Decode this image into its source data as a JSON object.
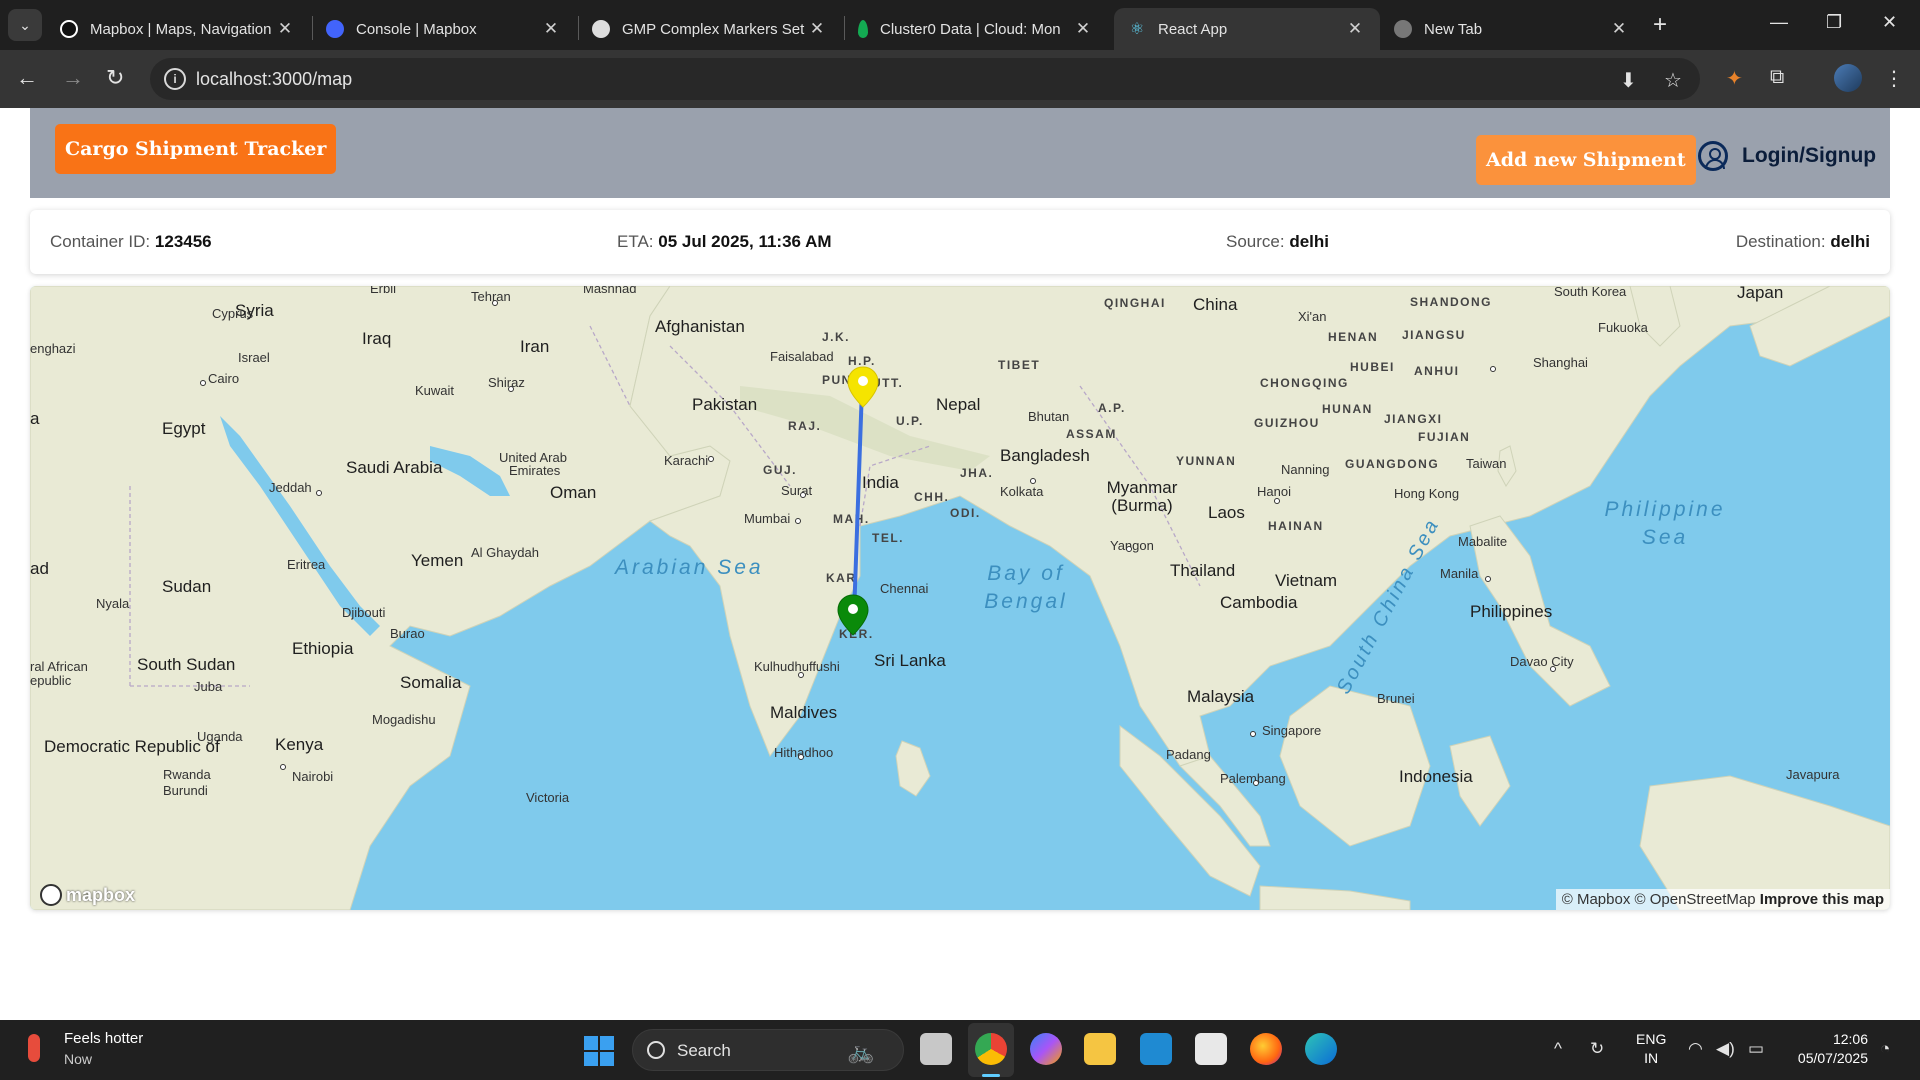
{
  "browser": {
    "tabs": [
      {
        "title": "Mapbox | Maps, Navigation",
        "favicon": "mapbox-icon",
        "active": false
      },
      {
        "title": "Console | Mapbox",
        "favicon": "mapbox-console-icon",
        "active": false
      },
      {
        "title": "GMP Complex Markers Set",
        "favicon": "gmp-icon",
        "active": false
      },
      {
        "title": "Cluster0 Data | Cloud: Mon",
        "favicon": "mongodb-leaf-icon",
        "active": false
      },
      {
        "title": "React App",
        "favicon": "react-icon",
        "active": true
      },
      {
        "title": "New Tab",
        "favicon": "chrome-icon",
        "active": false
      }
    ],
    "url": "localhost:3000/map"
  },
  "app": {
    "brand": "Cargo Shipment Tracker",
    "add_shipment": "Add new Shipment",
    "login": "Login/Signup",
    "colors": {
      "brand": "#f97316",
      "add_button": "#fb923c",
      "header_bg": "#9aa1ad"
    }
  },
  "shipment": {
    "container_label": "Container ID:",
    "container_id": "123456",
    "eta_label": "ETA:",
    "eta": "05 Jul 2025, 11:36 AM",
    "source_label": "Source:",
    "source": "delhi",
    "destination_label": "Destination:",
    "destination": "delhi"
  },
  "map": {
    "countries": [
      "Syria",
      "Iraq",
      "Iran",
      "Afghanistan",
      "China",
      "Japan",
      "Pakistan",
      "Nepal",
      "Bhutan",
      "Egypt",
      "Saudi Arabia",
      "Oman",
      "India",
      "Bangladesh",
      "Myanmar (Burma)",
      "Laos",
      "Taiwan",
      "Yemen",
      "Sudan",
      "Eritrea",
      "Thailand",
      "Vietnam",
      "Cambodia",
      "Philippines",
      "Djibouti",
      "Ethiopia",
      "Sri Lanka",
      "South Sudan",
      "Somalia",
      "Maldives",
      "Malaysia",
      "Brunei",
      "Kenya",
      "Uganda",
      "Rwanda",
      "Burundi",
      "Indonesia",
      "Democratic Republic of",
      "ral African",
      "epublic",
      "South Korea",
      "ad",
      "a"
    ],
    "cities": [
      "Erbil",
      "Tehran",
      "Mashhad",
      "Cyprus",
      "Israel",
      "Cairo",
      "Kuwait",
      "Shiraz",
      "Faisalabad",
      "Xi'an",
      "Fukuoka",
      "Shanghai",
      "Jeddah",
      "United Arab",
      "Emirates",
      "Karachi",
      "Surat",
      "Mumbai",
      "Kolkata",
      "Nanning",
      "Hanoi",
      "Hong Kong",
      "Al Ghaydah",
      "Chennai",
      "Yangon",
      "Mabalite",
      "Manila",
      "Nyala",
      "Burao",
      "Kulhudhuffushi",
      "Davao City",
      "Juba",
      "Mogadishu",
      "Hithadhoo",
      "Singapore",
      "Padang",
      "Palembang",
      "Nairobi",
      "Javapura",
      "Victoria",
      "enghazi"
    ],
    "regions": [
      "QINGHAI",
      "SHANDONG",
      "J.K.",
      "H.P.",
      "TIBET",
      "HENAN",
      "JIANGSU",
      "HUBEI",
      "ANHUI",
      "PUN",
      "UTT.",
      "CHONGQING",
      "A.P.",
      "HUNAN",
      "RAJ.",
      "U.P.",
      "ASSAM",
      "GUIZHOU",
      "JIANGXI",
      "FUJIAN",
      "GUJ.",
      "JHA.",
      "YUNNAN",
      "GUANGDONG",
      "CHH.",
      "MAH.",
      "ODI.",
      "HAINAN",
      "TEL.",
      "KAR",
      "KER."
    ],
    "seas": [
      "Arabian Sea",
      "Bay of Bengal",
      "Philippine Sea",
      "South China Sea"
    ],
    "logo": "mapbox",
    "attribution": {
      "mapbox": "© Mapbox",
      "osm": "© OpenStreetMap",
      "improve": "Improve this map"
    },
    "markers": [
      {
        "name": "origin",
        "color": "#f5e400"
      },
      {
        "name": "destination",
        "color": "#0a8a0a"
      }
    ],
    "route_color": "#3b6fe0",
    "water_color": "#7fcaec",
    "land_color": "#e9ead5"
  },
  "taskbar": {
    "weather_title": "Feels hotter",
    "weather_sub": "Now",
    "search": "Search",
    "lang1": "ENG",
    "lang2": "IN",
    "time": "12:06",
    "date": "05/07/2025"
  }
}
